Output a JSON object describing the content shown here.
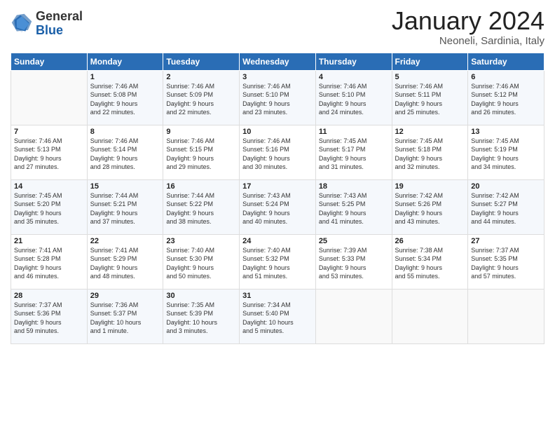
{
  "logo": {
    "general": "General",
    "blue": "Blue"
  },
  "title": {
    "month": "January 2024",
    "location": "Neoneli, Sardinia, Italy"
  },
  "weekdays": [
    "Sunday",
    "Monday",
    "Tuesday",
    "Wednesday",
    "Thursday",
    "Friday",
    "Saturday"
  ],
  "weeks": [
    [
      {
        "day": "",
        "sunrise": "",
        "sunset": "",
        "daylight": ""
      },
      {
        "day": "1",
        "sunrise": "Sunrise: 7:46 AM",
        "sunset": "Sunset: 5:08 PM",
        "daylight": "Daylight: 9 hours and 22 minutes."
      },
      {
        "day": "2",
        "sunrise": "Sunrise: 7:46 AM",
        "sunset": "Sunset: 5:09 PM",
        "daylight": "Daylight: 9 hours and 22 minutes."
      },
      {
        "day": "3",
        "sunrise": "Sunrise: 7:46 AM",
        "sunset": "Sunset: 5:10 PM",
        "daylight": "Daylight: 9 hours and 23 minutes."
      },
      {
        "day": "4",
        "sunrise": "Sunrise: 7:46 AM",
        "sunset": "Sunset: 5:10 PM",
        "daylight": "Daylight: 9 hours and 24 minutes."
      },
      {
        "day": "5",
        "sunrise": "Sunrise: 7:46 AM",
        "sunset": "Sunset: 5:11 PM",
        "daylight": "Daylight: 9 hours and 25 minutes."
      },
      {
        "day": "6",
        "sunrise": "Sunrise: 7:46 AM",
        "sunset": "Sunset: 5:12 PM",
        "daylight": "Daylight: 9 hours and 26 minutes."
      }
    ],
    [
      {
        "day": "7",
        "sunrise": "Sunrise: 7:46 AM",
        "sunset": "Sunset: 5:13 PM",
        "daylight": "Daylight: 9 hours and 27 minutes."
      },
      {
        "day": "8",
        "sunrise": "Sunrise: 7:46 AM",
        "sunset": "Sunset: 5:14 PM",
        "daylight": "Daylight: 9 hours and 28 minutes."
      },
      {
        "day": "9",
        "sunrise": "Sunrise: 7:46 AM",
        "sunset": "Sunset: 5:15 PM",
        "daylight": "Daylight: 9 hours and 29 minutes."
      },
      {
        "day": "10",
        "sunrise": "Sunrise: 7:46 AM",
        "sunset": "Sunset: 5:16 PM",
        "daylight": "Daylight: 9 hours and 30 minutes."
      },
      {
        "day": "11",
        "sunrise": "Sunrise: 7:45 AM",
        "sunset": "Sunset: 5:17 PM",
        "daylight": "Daylight: 9 hours and 31 minutes."
      },
      {
        "day": "12",
        "sunrise": "Sunrise: 7:45 AM",
        "sunset": "Sunset: 5:18 PM",
        "daylight": "Daylight: 9 hours and 32 minutes."
      },
      {
        "day": "13",
        "sunrise": "Sunrise: 7:45 AM",
        "sunset": "Sunset: 5:19 PM",
        "daylight": "Daylight: 9 hours and 34 minutes."
      }
    ],
    [
      {
        "day": "14",
        "sunrise": "Sunrise: 7:45 AM",
        "sunset": "Sunset: 5:20 PM",
        "daylight": "Daylight: 9 hours and 35 minutes."
      },
      {
        "day": "15",
        "sunrise": "Sunrise: 7:44 AM",
        "sunset": "Sunset: 5:21 PM",
        "daylight": "Daylight: 9 hours and 37 minutes."
      },
      {
        "day": "16",
        "sunrise": "Sunrise: 7:44 AM",
        "sunset": "Sunset: 5:22 PM",
        "daylight": "Daylight: 9 hours and 38 minutes."
      },
      {
        "day": "17",
        "sunrise": "Sunrise: 7:43 AM",
        "sunset": "Sunset: 5:24 PM",
        "daylight": "Daylight: 9 hours and 40 minutes."
      },
      {
        "day": "18",
        "sunrise": "Sunrise: 7:43 AM",
        "sunset": "Sunset: 5:25 PM",
        "daylight": "Daylight: 9 hours and 41 minutes."
      },
      {
        "day": "19",
        "sunrise": "Sunrise: 7:42 AM",
        "sunset": "Sunset: 5:26 PM",
        "daylight": "Daylight: 9 hours and 43 minutes."
      },
      {
        "day": "20",
        "sunrise": "Sunrise: 7:42 AM",
        "sunset": "Sunset: 5:27 PM",
        "daylight": "Daylight: 9 hours and 44 minutes."
      }
    ],
    [
      {
        "day": "21",
        "sunrise": "Sunrise: 7:41 AM",
        "sunset": "Sunset: 5:28 PM",
        "daylight": "Daylight: 9 hours and 46 minutes."
      },
      {
        "day": "22",
        "sunrise": "Sunrise: 7:41 AM",
        "sunset": "Sunset: 5:29 PM",
        "daylight": "Daylight: 9 hours and 48 minutes."
      },
      {
        "day": "23",
        "sunrise": "Sunrise: 7:40 AM",
        "sunset": "Sunset: 5:30 PM",
        "daylight": "Daylight: 9 hours and 50 minutes."
      },
      {
        "day": "24",
        "sunrise": "Sunrise: 7:40 AM",
        "sunset": "Sunset: 5:32 PM",
        "daylight": "Daylight: 9 hours and 51 minutes."
      },
      {
        "day": "25",
        "sunrise": "Sunrise: 7:39 AM",
        "sunset": "Sunset: 5:33 PM",
        "daylight": "Daylight: 9 hours and 53 minutes."
      },
      {
        "day": "26",
        "sunrise": "Sunrise: 7:38 AM",
        "sunset": "Sunset: 5:34 PM",
        "daylight": "Daylight: 9 hours and 55 minutes."
      },
      {
        "day": "27",
        "sunrise": "Sunrise: 7:37 AM",
        "sunset": "Sunset: 5:35 PM",
        "daylight": "Daylight: 9 hours and 57 minutes."
      }
    ],
    [
      {
        "day": "28",
        "sunrise": "Sunrise: 7:37 AM",
        "sunset": "Sunset: 5:36 PM",
        "daylight": "Daylight: 9 hours and 59 minutes."
      },
      {
        "day": "29",
        "sunrise": "Sunrise: 7:36 AM",
        "sunset": "Sunset: 5:37 PM",
        "daylight": "Daylight: 10 hours and 1 minute."
      },
      {
        "day": "30",
        "sunrise": "Sunrise: 7:35 AM",
        "sunset": "Sunset: 5:39 PM",
        "daylight": "Daylight: 10 hours and 3 minutes."
      },
      {
        "day": "31",
        "sunrise": "Sunrise: 7:34 AM",
        "sunset": "Sunset: 5:40 PM",
        "daylight": "Daylight: 10 hours and 5 minutes."
      },
      {
        "day": "",
        "sunrise": "",
        "sunset": "",
        "daylight": ""
      },
      {
        "day": "",
        "sunrise": "",
        "sunset": "",
        "daylight": ""
      },
      {
        "day": "",
        "sunrise": "",
        "sunset": "",
        "daylight": ""
      }
    ]
  ]
}
